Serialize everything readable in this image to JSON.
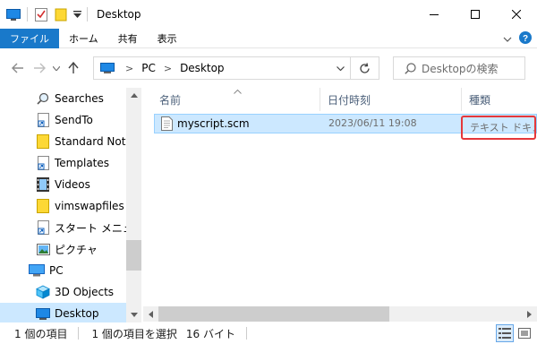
{
  "window": {
    "title": "Desktop",
    "controls": [
      "minimize",
      "maximize",
      "close"
    ]
  },
  "ribbon": {
    "tabs": [
      "ファイル",
      "ホーム",
      "共有",
      "表示"
    ]
  },
  "address": {
    "crumbs": [
      "PC",
      "Desktop"
    ],
    "search_placeholder": "Desktopの検索"
  },
  "nav": {
    "items": [
      {
        "label": "Searches",
        "icon": "search-icon"
      },
      {
        "label": "SendTo",
        "icon": "shortcut-file-icon"
      },
      {
        "label": "Standard Notes",
        "icon": "folder-icon"
      },
      {
        "label": "Templates",
        "icon": "shortcut-file-icon"
      },
      {
        "label": "Videos",
        "icon": "film-icon"
      },
      {
        "label": "vimswapfiles",
        "icon": "folder-icon"
      },
      {
        "label": "スタート メニュー",
        "icon": "shortcut-file-icon"
      },
      {
        "label": "ピクチャ",
        "icon": "picture-icon"
      },
      {
        "label": "PC",
        "icon": "computer-icon"
      },
      {
        "label": "3D Objects",
        "icon": "cube-icon"
      },
      {
        "label": "Desktop",
        "icon": "desktop-icon",
        "selected": true
      }
    ]
  },
  "list": {
    "columns": [
      "名前",
      "日付時刻",
      "種類"
    ],
    "rows": [
      {
        "name": "myscript.scm",
        "date": "2023/06/11 19:08",
        "type": "テキスト ドキュメント",
        "selected": true
      }
    ]
  },
  "status": {
    "count": "1 個の項目",
    "selection": "1 個の項目を選択",
    "size": "16 バイト"
  },
  "colors": {
    "accent": "#1979ca",
    "selection_bg": "#cce8ff",
    "selection_border": "#99d1ff",
    "highlight_box": "#e5383b"
  }
}
